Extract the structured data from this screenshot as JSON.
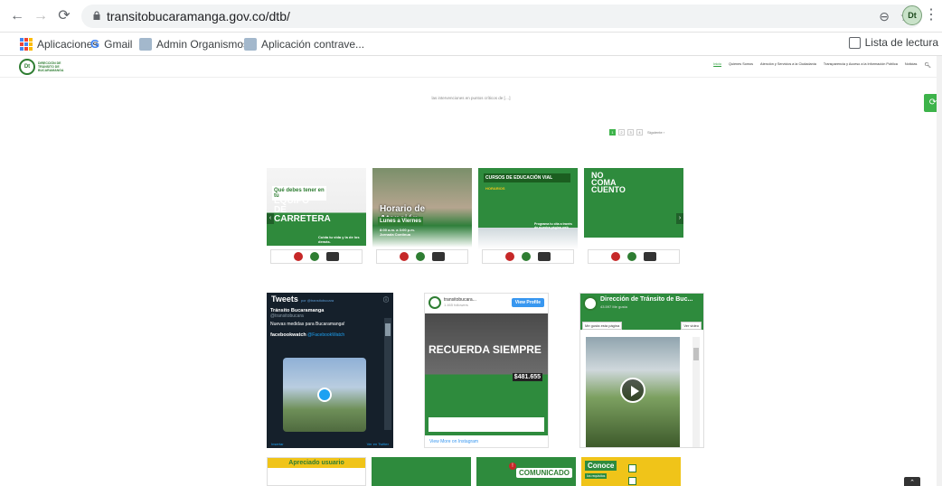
{
  "browser": {
    "url": "transitobucaramanga.gov.co/dtb/",
    "bookmarks": [
      "Aplicaciones",
      "Gmail",
      "Admin Organismos...",
      "Aplicación contrave..."
    ],
    "reading_list": "Lista de lectura",
    "profile_initials": "Dt"
  },
  "site": {
    "logo_initials": "Dt",
    "logo_text": "DIRECCIÓN DE TRÁNSITO DE BUCARAMANGA",
    "menu": [
      "Inicio",
      "Quienes Somos",
      "Atención y Servicios a la Ciudadanía",
      "Transparencia y Acceso a la Información Pública",
      "Noticias"
    ],
    "excerpt": "las intervenciones en puntos críticos de […]",
    "pagination": [
      "1",
      "2",
      "3",
      "4"
    ],
    "pagination_next": "Siguiente ›"
  },
  "posts": [
    {
      "line1": "Qué debes tener en tu",
      "line2": "EQUIPO DE CARRETERA",
      "tag": "Cuida tu vida y la de los demás."
    },
    {
      "line1": "Horario de Atención",
      "line2": "Lunes a Viernes",
      "tag": "8:00 a.m. a 3:00 p.m. Jornada Continua"
    },
    {
      "line1": "CURSOS DE EDUCACIÓN VIAL",
      "line2": "HORARIOS",
      "tag": "Programa tu cita a través de nuestra página web"
    },
    {
      "line1": "NO COMA CUENTO",
      "line2": "",
      "tag": ""
    }
  ],
  "twitter": {
    "title": "Tweets",
    "by": "por @transitobucara",
    "account": "Tránsito Bucaramanga",
    "handle": "@transitobucara",
    "text": "Nuevas medidas para Bucaramanga!",
    "watch": "facebookwatch",
    "watch_handle": "@FacebookWatch",
    "embed": "Insertar",
    "view_on": "Ver en Twitter"
  },
  "instagram": {
    "name": "transitobucara...",
    "followers": "1.465 followers",
    "button": "View Profile",
    "headline": "RECUERDA SIEMPRE",
    "price": "$481.655",
    "footer": "View More on Instagram"
  },
  "facebook": {
    "title": "Dirección de Tránsito de Buc...",
    "likes": "43.597 Me gusta",
    "like_btn": "Me gusta esta página",
    "video_btn": "Ver video"
  },
  "bottom": [
    {
      "title": "Apreciado usuario"
    },
    {
      "title": ""
    },
    {
      "title": "COMUNICADO"
    },
    {
      "title": "Conoce",
      "sub": "los requisitos"
    }
  ]
}
